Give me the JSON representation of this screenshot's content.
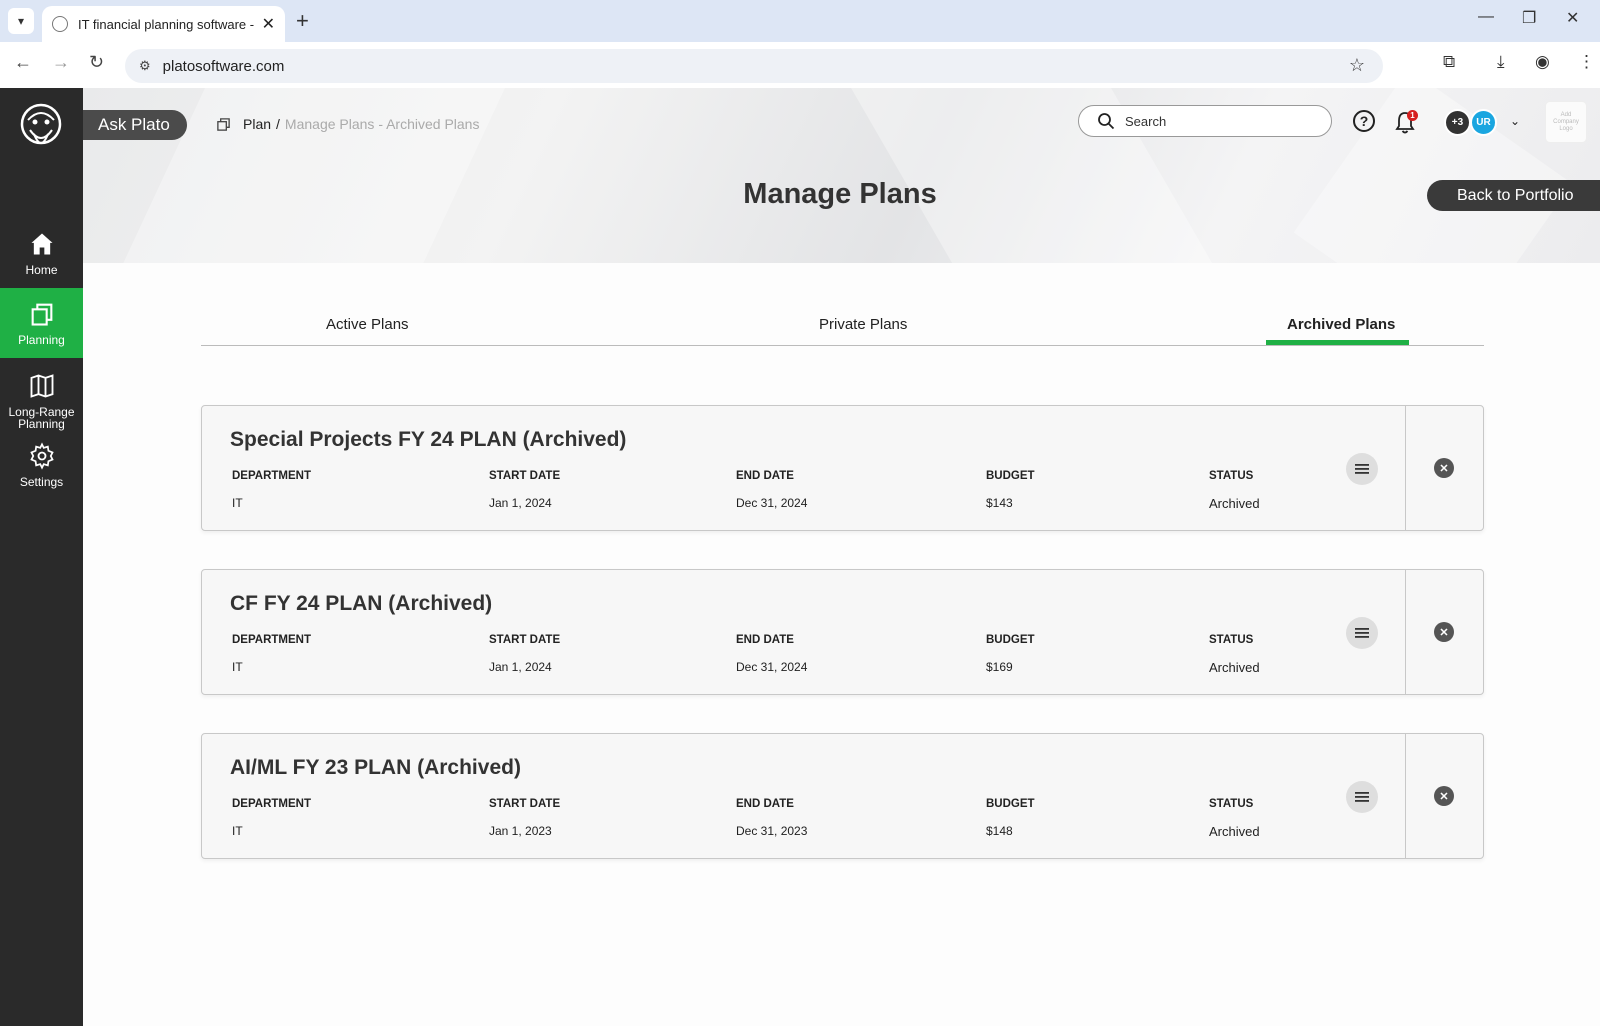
{
  "browser": {
    "tab_title": "IT financial planning software - ",
    "url": "platosoftware.com"
  },
  "sidebar": {
    "items": [
      {
        "label": "Home",
        "icon": "home-icon",
        "active": false
      },
      {
        "label": "Planning",
        "icon": "planning-icon",
        "active": true
      },
      {
        "label": "Long-Range Planning",
        "icon": "map-icon",
        "active": false
      },
      {
        "label": "Settings",
        "icon": "gear-icon",
        "active": false
      }
    ],
    "active_color": "#1fb045"
  },
  "header": {
    "ask_plato": "Ask Plato",
    "breadcrumb": {
      "root": "Plan",
      "separator": "/",
      "current": "Manage Plans - Archived Plans"
    },
    "search_placeholder": "Search",
    "notification_count": "1",
    "avatar_more": "+3",
    "avatar_initials": "UR",
    "company_logo_text": "Add Company Logo",
    "title": "Manage Plans",
    "back_button": "Back to Portfolio"
  },
  "tabs": [
    {
      "label": "Active Plans",
      "active": false
    },
    {
      "label": "Private Plans",
      "active": false
    },
    {
      "label": "Archived Plans",
      "active": true
    }
  ],
  "columns": {
    "department": "DEPARTMENT",
    "start_date": "START DATE",
    "end_date": "END DATE",
    "budget": "BUDGET",
    "status": "STATUS"
  },
  "plans": [
    {
      "name": "Special Projects FY 24 PLAN (Archived)",
      "department": "IT",
      "start_date": "Jan 1, 2024",
      "end_date": "Dec 31, 2024",
      "budget": "$143",
      "status": "Archived"
    },
    {
      "name": "CF FY 24 PLAN (Archived)",
      "department": "IT",
      "start_date": "Jan 1, 2024",
      "end_date": "Dec 31, 2024",
      "budget": "$169",
      "status": "Archived"
    },
    {
      "name": "AI/ML FY 23 PLAN (Archived)",
      "department": "IT",
      "start_date": "Jan 1, 2023",
      "end_date": "Dec 31, 2023",
      "budget": "$148",
      "status": "Archived"
    }
  ]
}
